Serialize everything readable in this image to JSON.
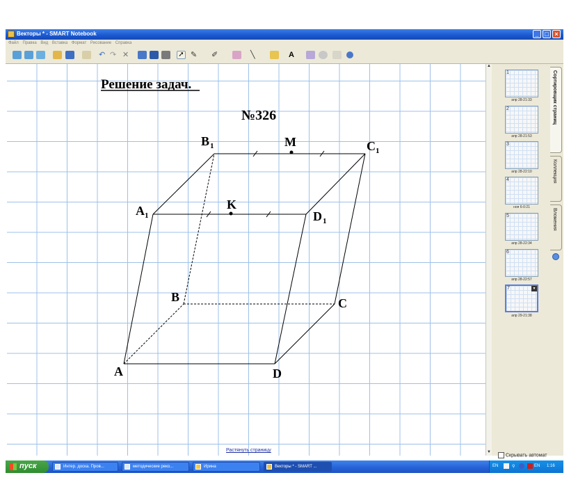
{
  "window": {
    "title": "Векторы * - SMART Notebook",
    "icons": {
      "app": "smart-notebook-icon",
      "minimize": "minimize-icon",
      "maximize": "maximize-icon",
      "close": "close-icon"
    },
    "buttons": {
      "minimize": "_",
      "maximize": "□",
      "close": "×"
    }
  },
  "menu": {
    "items": [
      "Файл",
      "Правка",
      "Вид",
      "Вставка",
      "Формат",
      "Рисование",
      "Справка"
    ]
  },
  "toolbar": {
    "icons": [
      "back-icon",
      "forward-icon",
      "add-page-icon",
      "open-icon",
      "save-icon",
      "paste-icon",
      "undo-icon",
      "redo-icon",
      "delete-icon",
      "screen-shade-icon",
      "full-screen-icon",
      "table-icon",
      "select-icon",
      "pen-icon",
      "creative-pen-icon",
      "eraser-icon",
      "line-icon",
      "fill-icon",
      "text-icon",
      "shape-icon",
      "properties-icon",
      "move-toolbar-icon",
      "more-icon"
    ],
    "colors": {
      "bg": "#ece9d8"
    }
  },
  "page": {
    "heading": "Решение задач.",
    "problem_number": "№326",
    "link_stretch": "Растянуть страницу",
    "labels": {
      "A": "A",
      "B": "B",
      "C": "C",
      "D": "D",
      "A1": "A",
      "B1": "B",
      "C1": "C",
      "D1": "D",
      "sub1": "1",
      "K": "K",
      "M": "M"
    }
  },
  "side_panel": {
    "thumbs": [
      {
        "num": "1",
        "date": "апр 28-21:33"
      },
      {
        "num": "2",
        "date": "апр 28-21:53"
      },
      {
        "num": "3",
        "date": "апр 28-22:10"
      },
      {
        "num": "4",
        "date": "ноя 6-0:21"
      },
      {
        "num": "5",
        "date": "апр 28-22:34"
      },
      {
        "num": "6",
        "date": "апр 28-22:57"
      },
      {
        "num": "7",
        "date": "апр 29-21:38"
      }
    ],
    "tabs": [
      "Сортировщик страниц",
      "Коллекция",
      "Вложения"
    ],
    "autohide": "Скрывать автомат"
  },
  "taskbar": {
    "start": "пуск",
    "tasks": [
      "Интер. доска. Пров...",
      "методические реко...",
      "Ирина",
      "Векторы * - SMART ..."
    ],
    "tray": {
      "lang": "EN",
      "lang2": "EN",
      "time": "1:16"
    }
  },
  "colors": {
    "grid": "#9ec0e8",
    "titlebar": "#1a57cf",
    "taskbar": "#2663d8",
    "start": "#2f8c2f",
    "link": "#1c2fa6"
  }
}
